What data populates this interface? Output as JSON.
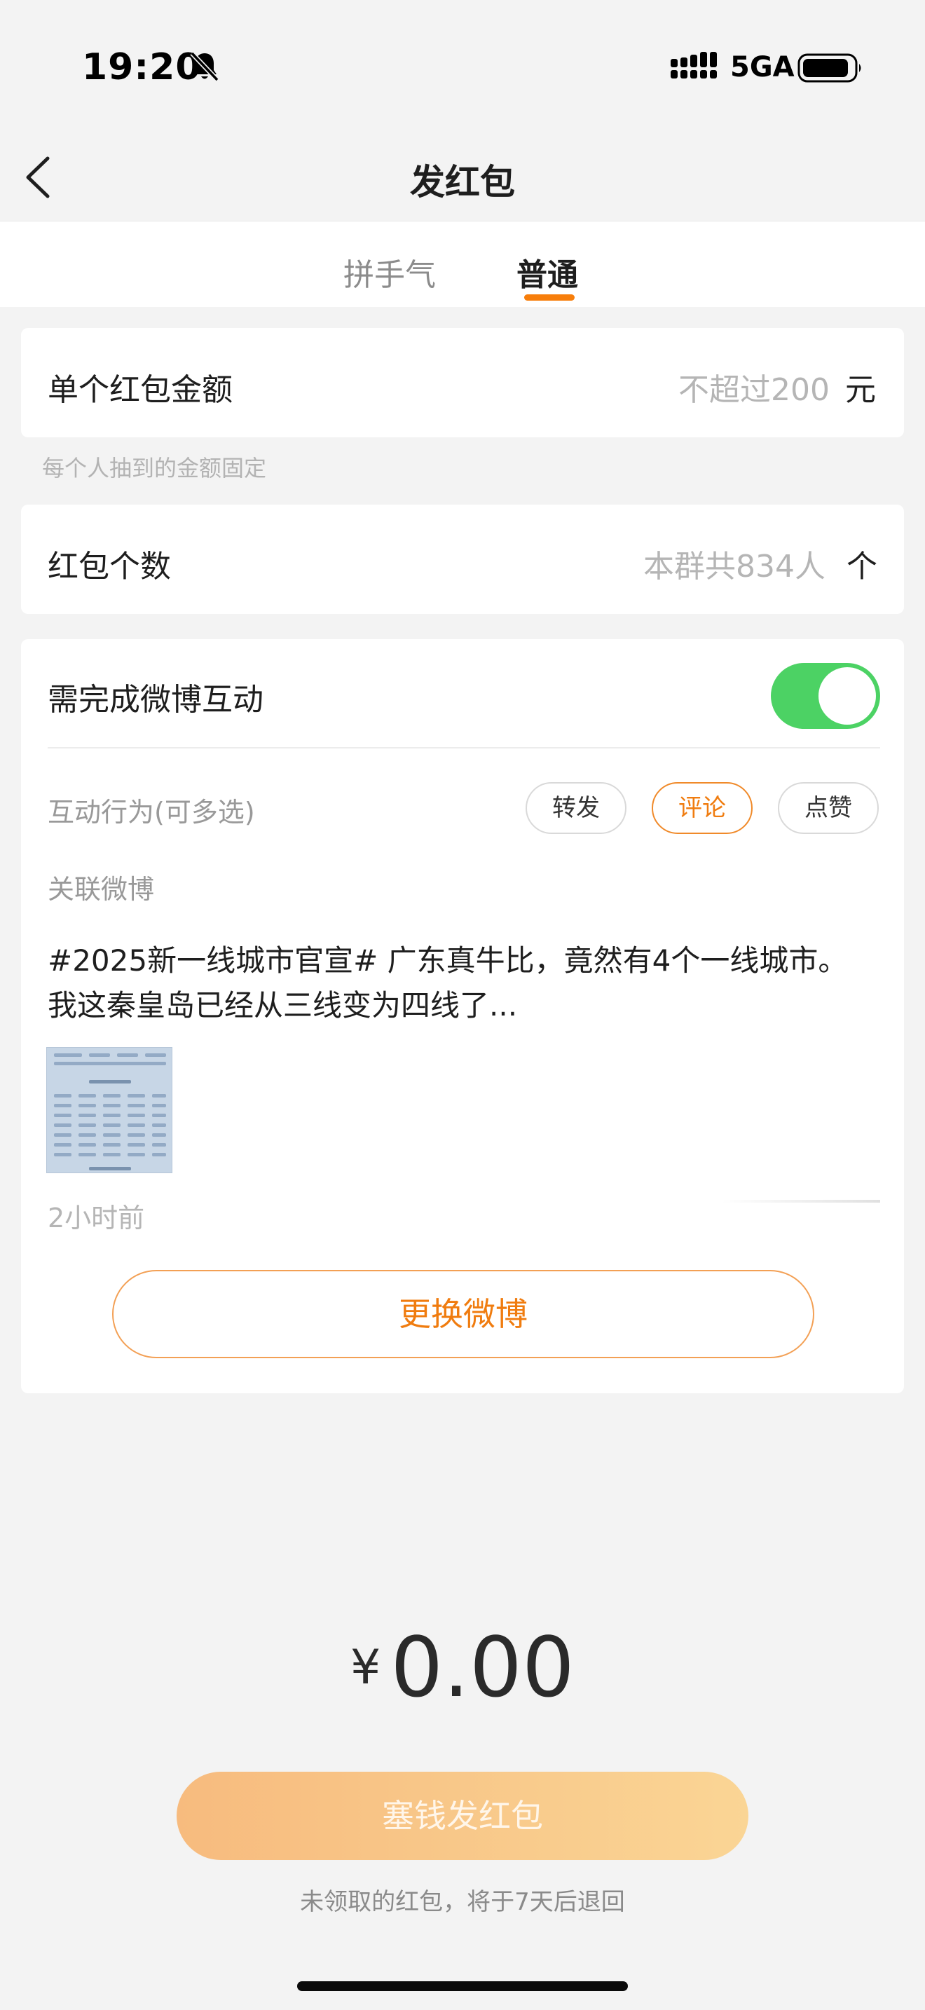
{
  "status_bar": {
    "time": "19:20",
    "network": "5GA",
    "icons": [
      "bell-slash-icon",
      "signal-icon",
      "battery-icon"
    ]
  },
  "nav": {
    "title": "发红包",
    "back_icon": "chevron-left-icon"
  },
  "tabs": [
    {
      "label": "拼手气",
      "selected": false
    },
    {
      "label": "普通",
      "selected": true
    }
  ],
  "amount_row": {
    "label": "单个红包金额",
    "placeholder": "不超过200",
    "unit": "元",
    "hint": "每个人抽到的金额固定"
  },
  "count_row": {
    "label": "红包个数",
    "placeholder": "本群共834人",
    "unit": "个"
  },
  "interaction": {
    "label": "需完成微博互动",
    "toggle_on": true,
    "action_label": "互动行为(可多选)",
    "chips": [
      {
        "label": "转发",
        "selected": false
      },
      {
        "label": "评论",
        "selected": true
      },
      {
        "label": "点赞",
        "selected": false
      }
    ],
    "linked_label": "关联微博",
    "post_line1": "#2025新一线城市官宣# 广东真牛比，竟然有4个一线城市。",
    "post_line2": "我这秦皇岛已经从三线变为四线了...",
    "post_time": "2小时前",
    "change_button": "更换微博"
  },
  "total": {
    "currency": "¥",
    "value": "0.00"
  },
  "send_button": "塞钱发红包",
  "footnote": "未领取的红包，将于7天后退回",
  "colors": {
    "accent": "#f07c0f",
    "toggle_on": "#4cd264",
    "button_gradient_start": "#f7bb7e",
    "button_gradient_end": "#fad595",
    "background": "#f3f3f3"
  }
}
